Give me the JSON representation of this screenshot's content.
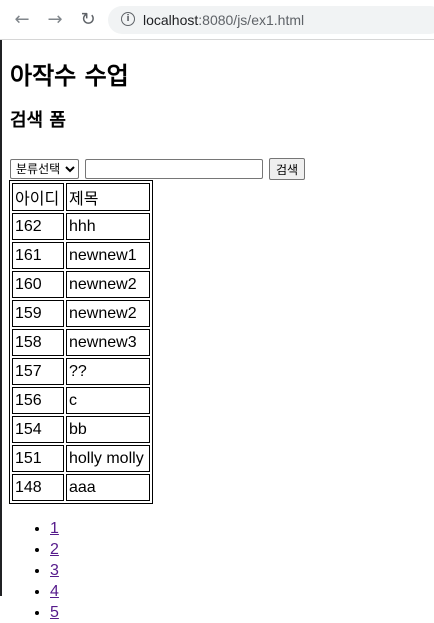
{
  "browser": {
    "url_host": "localhost",
    "url_rest": ":8080/js/ex1.html"
  },
  "page": {
    "title": "아작수 수업",
    "subtitle": "검색 폼"
  },
  "search": {
    "category_selected": "분류선택",
    "query_value": "",
    "button_label": "검색"
  },
  "table": {
    "headers": [
      "아이디",
      "제목"
    ],
    "rows": [
      {
        "id": "162",
        "title": "hhh"
      },
      {
        "id": "161",
        "title": "newnew1"
      },
      {
        "id": "160",
        "title": "newnew2"
      },
      {
        "id": "159",
        "title": "newnew2"
      },
      {
        "id": "158",
        "title": "newnew3"
      },
      {
        "id": "157",
        "title": "??"
      },
      {
        "id": "156",
        "title": "c"
      },
      {
        "id": "154",
        "title": "bb"
      },
      {
        "id": "151",
        "title": "holly molly"
      },
      {
        "id": "148",
        "title": "aaa"
      }
    ]
  },
  "pagination": [
    "1",
    "2",
    "3",
    "4",
    "5"
  ],
  "icons": {
    "back": "arrow-left-icon",
    "forward": "arrow-right-icon",
    "reload": "reload-icon",
    "info": "info-icon"
  }
}
